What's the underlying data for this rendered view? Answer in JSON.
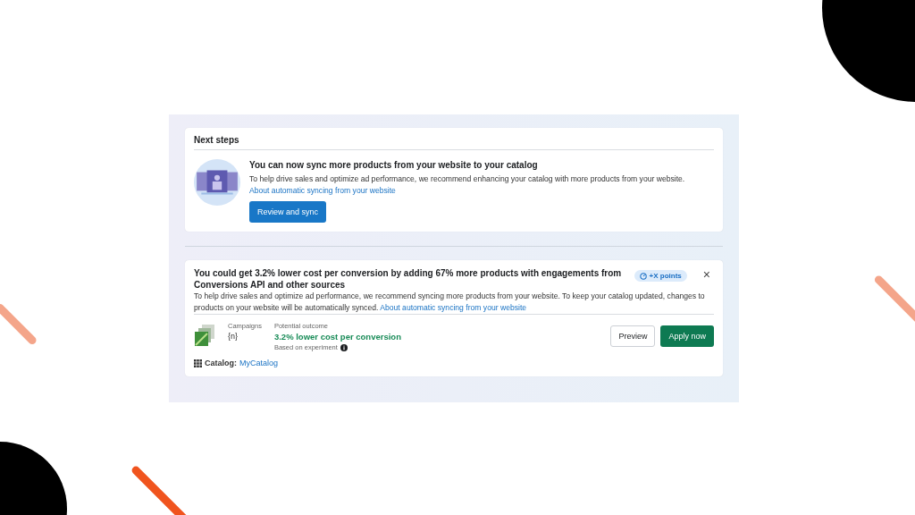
{
  "next_steps": {
    "heading": "Next steps",
    "title": "You can now sync more products from your website to your catalog",
    "body": "To help drive sales and optimize ad performance, we recommend enhancing your catalog with more products from your website.",
    "link": "About automatic syncing from your website",
    "button": "Review and sync"
  },
  "recommendation": {
    "title": "You could get 3.2% lower cost per conversion by adding 67% more products with engagements from Conversions API and other sources",
    "badge": "+X points",
    "close": "×",
    "body": "To help drive sales and optimize ad performance, we recommend syncing more products from your website. To keep your catalog updated, changes to products on your website will be automatically synced.",
    "link": "About automatic syncing from your website",
    "campaigns_label": "Campaigns",
    "campaigns_value": "{n}",
    "outcome_label": "Potential outcome",
    "outcome_value": "3.2% lower cost per conversion",
    "outcome_note": "Based on experiment",
    "buttons": [
      {
        "label": "Preview",
        "kind": "secondary"
      },
      {
        "label": "Apply now",
        "kind": "primary"
      }
    ],
    "catalog_label": "Catalog:",
    "catalog_link": "MyCatalog"
  }
}
